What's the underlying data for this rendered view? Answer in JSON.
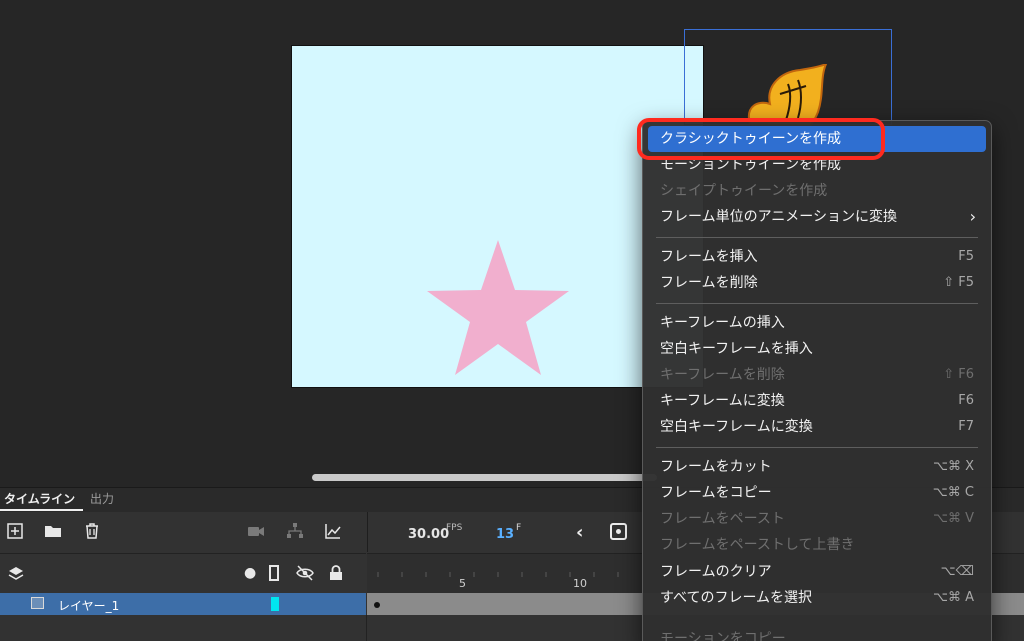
{
  "timeline": {
    "tabs": [
      {
        "label": "タイムライン"
      },
      {
        "label": "出力"
      }
    ],
    "fps_value": "30.00",
    "fps_label": "FPS",
    "current_frame": "13",
    "frame_label": "F",
    "ruler_ticks": [
      "5",
      "10"
    ],
    "layer": {
      "name": "レイヤー_1",
      "color": "#00e5f0"
    }
  },
  "stage": {
    "background": "#d5f8ff",
    "star_color": "#f1afce"
  },
  "context_menu": {
    "items": [
      {
        "label": "クラシックトゥイーンを作成",
        "shortcut": "",
        "state": "highlighted"
      },
      {
        "label": "モーショントゥイーンを作成",
        "shortcut": "",
        "state": "enabled"
      },
      {
        "label": "シェイプトゥイーンを作成",
        "shortcut": "",
        "state": "disabled"
      },
      {
        "label": "フレーム単位のアニメーションに変換",
        "shortcut": "",
        "state": "submenu"
      },
      {
        "label": "フレームを挿入",
        "shortcut": "F5",
        "state": "enabled"
      },
      {
        "label": "フレームを削除",
        "shortcut": "⇧ F5",
        "state": "enabled"
      },
      {
        "label": "キーフレームの挿入",
        "shortcut": "",
        "state": "enabled"
      },
      {
        "label": "空白キーフレームを挿入",
        "shortcut": "",
        "state": "enabled"
      },
      {
        "label": "キーフレームを削除",
        "shortcut": "⇧ F6",
        "state": "disabled"
      },
      {
        "label": "キーフレームに変換",
        "shortcut": "F6",
        "state": "enabled"
      },
      {
        "label": "空白キーフレームに変換",
        "shortcut": "F7",
        "state": "enabled"
      },
      {
        "label": "フレームをカット",
        "shortcut": "⌥⌘ X",
        "state": "enabled"
      },
      {
        "label": "フレームをコピー",
        "shortcut": "⌥⌘ C",
        "state": "enabled"
      },
      {
        "label": "フレームをペースト",
        "shortcut": "⌥⌘ V",
        "state": "disabled"
      },
      {
        "label": "フレームをペーストして上書き",
        "shortcut": "",
        "state": "disabled"
      },
      {
        "label": "フレームのクリア",
        "shortcut": "⌥⌫",
        "state": "enabled"
      },
      {
        "label": "すべてのフレームを選択",
        "shortcut": "⌥⌘ A",
        "state": "enabled"
      },
      {
        "label": "モーションをコピー",
        "shortcut": "",
        "state": "disabled"
      }
    ],
    "highlight_color": "#2f6fd1",
    "callout_color": "#ff2a1f"
  },
  "icons": {
    "new_layer": "add-layer-icon",
    "new_folder": "folder-icon",
    "delete": "trash-icon",
    "camera": "camera-icon",
    "parent": "hierarchy-icon",
    "graph": "graph-icon",
    "layers": "layers-icon",
    "dot": "bullet-icon",
    "outline": "outline-icon",
    "visibility": "eye-hidden-icon",
    "lock": "lock-icon"
  }
}
